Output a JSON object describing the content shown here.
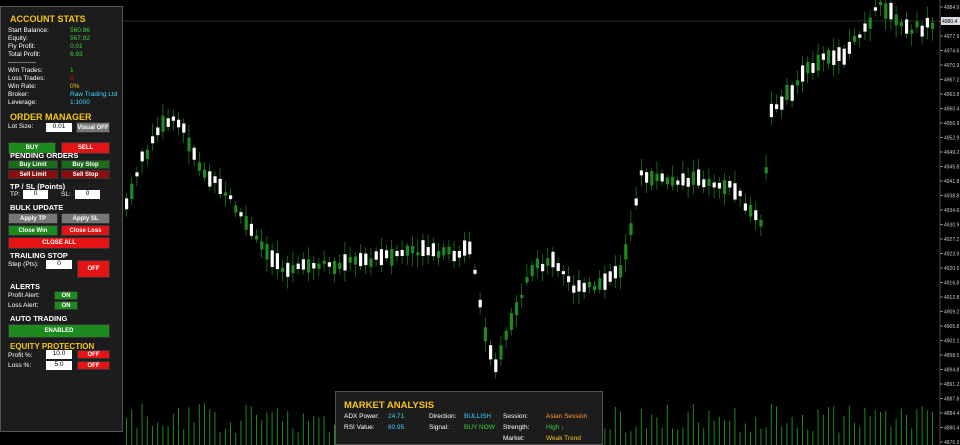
{
  "account": {
    "title": "ACCOUNT STATS",
    "rows": [
      {
        "k": "Start Balance:",
        "v": "560.96"
      },
      {
        "k": "Equity:",
        "v": "567.92"
      },
      {
        "k": "Fly Profit:",
        "v": "0.01"
      },
      {
        "k": "Total Profit:",
        "v": "6.93"
      },
      {
        "k": "-------------",
        "v": ""
      },
      {
        "k": "Win Trades:",
        "v": "1"
      },
      {
        "k": "Loss Trades:",
        "v": "0"
      },
      {
        "k": "Win Rate:",
        "v": "0%"
      },
      {
        "k": "Broker:",
        "v": "Raw Trading Ltd"
      },
      {
        "k": "Leverage:",
        "v": "1:1000"
      }
    ],
    "value_colors": [
      "#39d139",
      "#39d139",
      "#39d139",
      "#39d139",
      "#fff",
      "#39d139",
      "#e51414",
      "#f5c518",
      "#3fd0ff",
      "#3fd0ff"
    ]
  },
  "order": {
    "title": "ORDER MANAGER",
    "lot_label": "Lot Size:",
    "lot_value": "0.01",
    "visual_label": "Visual OFF",
    "buy": "BUY",
    "sell": "SELL",
    "pending_title": "PENDING ORDERS",
    "buy_limit": "Buy Limit",
    "buy_stop": "Buy Stop",
    "sell_limit": "Sell Limit",
    "sell_stop": "Sell Stop",
    "tpsl_title": "TP / SL (Points)",
    "tp_label": "TP:",
    "tp_value": "0",
    "sl_label": "SL:",
    "sl_value": "0"
  },
  "bulk": {
    "title": "BULK UPDATE",
    "apply_tp": "Apply TP",
    "apply_sl": "Apply SL",
    "close_win": "Close Win",
    "close_loss": "Close Loss",
    "close_all": "CLOSE ALL"
  },
  "trailing": {
    "title": "TRAILING STOP",
    "step_label": "Step (Pts):",
    "step_value": "0",
    "toggle": "OFF"
  },
  "alerts": {
    "title": "ALERTS",
    "profit_label": "Profit Alert:",
    "profit_state": "ON",
    "loss_label": "Loss Alert:",
    "loss_state": "ON"
  },
  "auto": {
    "title": "AUTO TRADING",
    "state": "ENABLED"
  },
  "equity": {
    "title": "EQUITY PROTECTION",
    "profit_label": "Profit %:",
    "profit_value": "10.0",
    "profit_state": "OFF",
    "loss_label": "Loss %:",
    "loss_value": "5.0",
    "loss_state": "OFF"
  },
  "market": {
    "title": "MARKET ANALYSIS",
    "adx_label": "ADX Power:",
    "adx": "24.71",
    "rsi_label": "RSI Value:",
    "rsi": "60.95",
    "dir_label": "Direction:",
    "dir": "BULLISH",
    "sig_label": "Signal:",
    "sig": "BUY NOW",
    "session_label": "Session:",
    "session": "Asian Session",
    "strength_label": "Strength:",
    "strength": "High ↓",
    "mkt_label": "Market:",
    "mkt": "Weak Trend"
  },
  "price_axis": {
    "ticks": [
      "4984.9",
      "4981.2",
      "4977.9",
      "4974.6",
      "4970.9",
      "4967.2",
      "4963.8",
      "4960.4",
      "4956.9",
      "4952.9",
      "4949.2",
      "4945.8",
      "4941.8",
      "4938.8",
      "4934.6",
      "4930.9",
      "4927.2",
      "4923.9",
      "4920.5",
      "4916.8",
      "4912.8",
      "4909.2",
      "4905.8",
      "4902.1",
      "4898.5",
      "4894.8",
      "4891.2",
      "4887.8",
      "4884.4",
      "4880.4",
      "4876.9"
    ],
    "current": "4980.4"
  },
  "colors": {
    "bull": "#ffffff",
    "bear": "#1e8a1e",
    "gold": "#f5c518",
    "bg": "#000000"
  }
}
